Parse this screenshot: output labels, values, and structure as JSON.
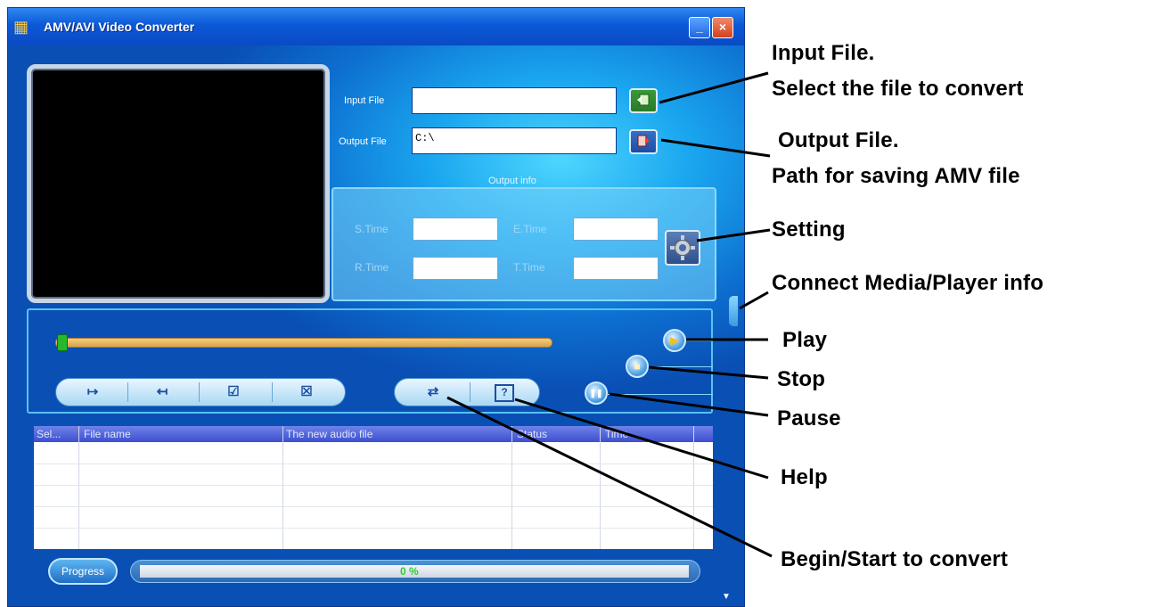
{
  "window": {
    "title": "AMV/AVI Video Converter"
  },
  "titlebar": {
    "minimize_glyph": "_",
    "close_glyph": "×",
    "app_icon": "film-icon"
  },
  "files": {
    "input_label": "Input File",
    "input_value": "",
    "output_label": "Output File",
    "output_value": "C:\\"
  },
  "output_info": {
    "title": "Output info",
    "s_time_label": "S.Time",
    "e_time_label": "E.Time",
    "r_time_label": "R.Time",
    "t_time_label": "T.Time",
    "s_time_value": "",
    "e_time_value": "",
    "r_time_value": "",
    "t_time_value": ""
  },
  "toolbar": {
    "mark_start_glyph": "↦",
    "mark_end_glyph": "↤",
    "check_glyph": "☑",
    "remove_glyph": "☒",
    "convert_glyph": "⇄",
    "help_glyph": "?"
  },
  "transport": {
    "play_glyph": "▶",
    "stop_glyph": "■",
    "pause_glyph": "❚❚"
  },
  "list": {
    "columns": [
      "Sel...",
      "File name",
      "The new audio file",
      "Status",
      "Time"
    ]
  },
  "progress": {
    "button_label": "Progress",
    "value_text": "0 %",
    "fraction": 0
  },
  "annotations": {
    "input_title": "Input File.",
    "input_desc": "Select the file to convert",
    "output_title": "Output File.",
    "output_desc": "Path for saving AMV file",
    "setting": "Setting",
    "connect": "Connect Media/Player info",
    "play": "Play",
    "stop": "Stop",
    "pause": "Pause",
    "help": "Help",
    "begin": "Begin/Start to convert"
  },
  "colors": {
    "window_blue": "#0d6fd0",
    "progress_text": "#33cc33",
    "slider": "#e0b060"
  }
}
